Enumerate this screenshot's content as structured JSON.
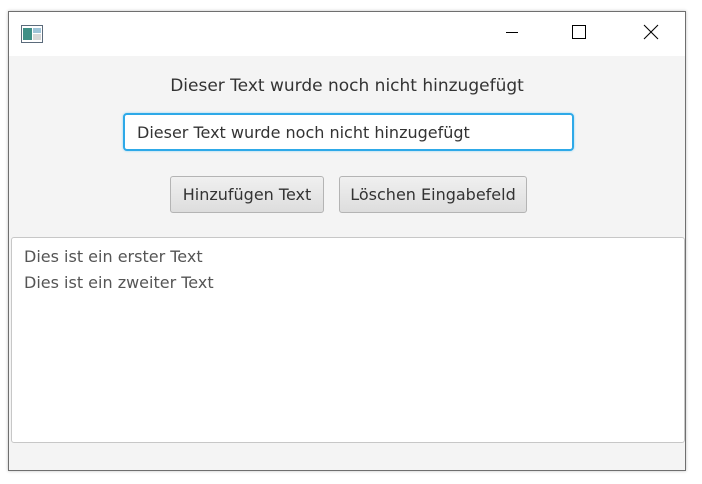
{
  "window": {
    "title": "",
    "icons": {
      "app": "java-app-icon",
      "minimize": "minimize-icon",
      "maximize": "maximize-icon",
      "close": "close-icon"
    }
  },
  "main": {
    "status_label": "Dieser Text wurde noch nicht hinzugefügt",
    "input": {
      "value": "Dieser Text wurde noch nicht hinzugefügt",
      "placeholder": ""
    },
    "buttons": {
      "add_label": "Hinzufügen Text",
      "clear_label": "Löschen Eingabefeld"
    },
    "text_area": {
      "lines": [
        "Dies ist ein erster Text",
        "Dies ist ein zweiter Text"
      ]
    }
  },
  "colors": {
    "focus_border": "#2ea9e8",
    "window_bg": "#f4f4f4"
  }
}
